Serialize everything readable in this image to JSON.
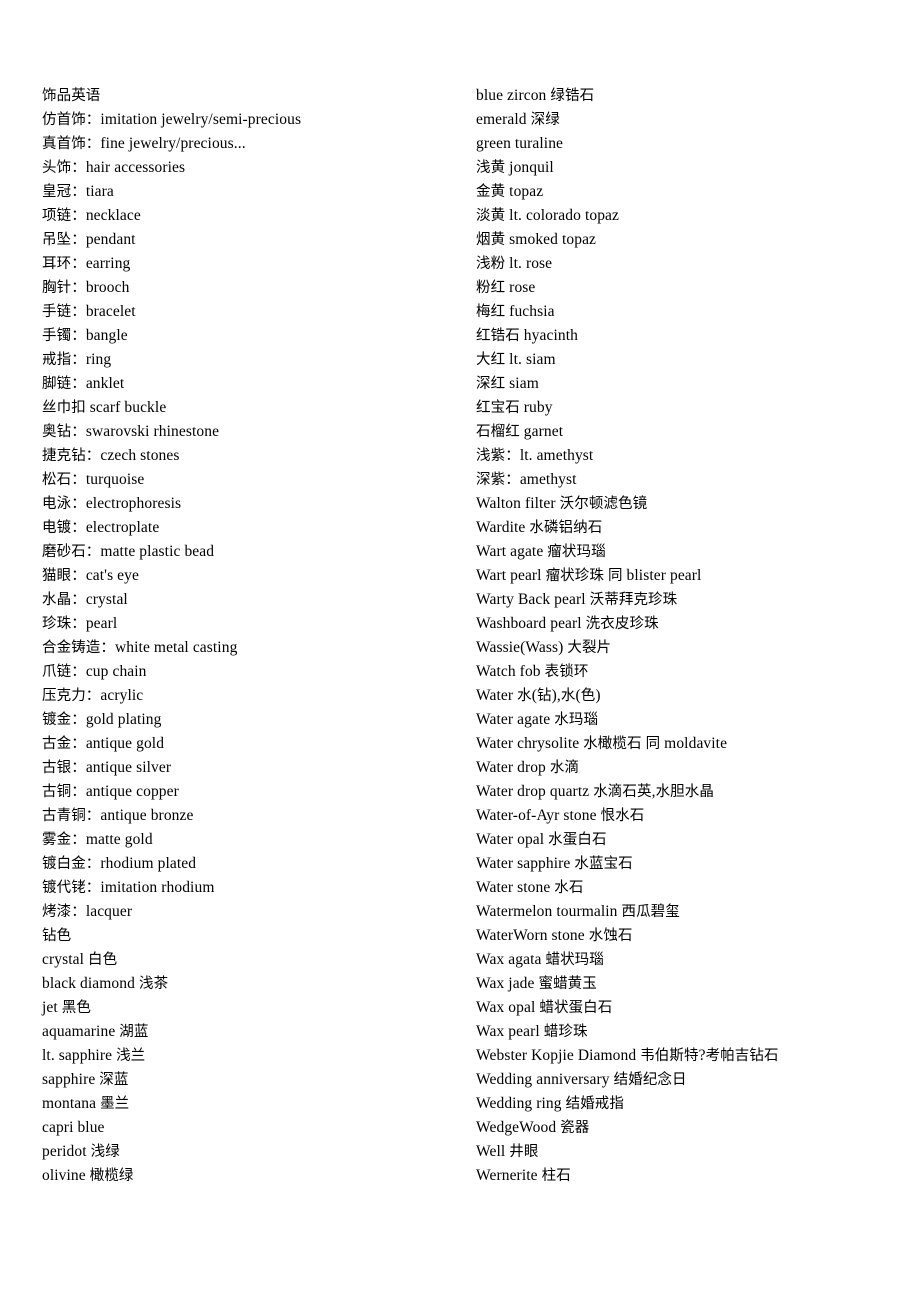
{
  "document": {
    "title": "饰品英语",
    "background_color": "#ffffff",
    "text_color": "#000000",
    "columns": [
      {
        "name": "left-column",
        "lines": [
          "饰品英语",
          "仿首饰：imitation jewelry/semi-precious",
          "真首饰：fine jewelry/precious...",
          "头饰：hair accessories",
          "皇冠：tiara",
          "项链：necklace",
          "吊坠：pendant",
          "耳环：earring",
          "胸针：brooch",
          "手链：bracelet",
          "手镯：bangle",
          "戒指：ring",
          "脚链：anklet",
          "丝巾扣 scarf buckle",
          "奥钻：swarovski rhinestone",
          "捷克钻：czech stones",
          "松石：turquoise",
          "电泳：electrophoresis",
          "电镀：electroplate",
          "磨砂石：matte plastic bead",
          "猫眼：cat's eye",
          "水晶：crystal",
          "珍珠：pearl",
          "合金铸造：white metal casting",
          "爪链：cup chain",
          "压克力：acrylic",
          "镀金：gold plating",
          "古金：antique gold",
          "古银：antique silver",
          "古铜：antique copper",
          "古青铜：antique bronze",
          "雾金：matte gold",
          "镀白金：rhodium plated",
          "镀代铑：imitation rhodium",
          "烤漆：lacquer",
          "钻色",
          "crystal 白色",
          "black diamond 浅茶",
          "jet 黑色",
          "aquamarine 湖蓝",
          "lt. sapphire 浅兰",
          "sapphire 深蓝",
          "montana 墨兰",
          "capri blue",
          "peridot 浅绿",
          "olivine 橄榄绿"
        ]
      },
      {
        "name": "right-column",
        "lines": [
          "blue zircon 绿锆石",
          "emerald 深绿",
          "green turaline",
          "浅黄 jonquil",
          "金黄 topaz",
          "淡黄 lt. colorado topaz",
          "烟黄 smoked topaz",
          "浅粉 lt. rose",
          "粉红 rose",
          "梅红 fuchsia",
          "红锆石 hyacinth",
          "大红 lt. siam",
          "深红 siam",
          "红宝石 ruby",
          "石榴红 garnet",
          "浅紫：lt. amethyst",
          "深紫：amethyst",
          "Walton filter 沃尔顿滤色镜",
          "Wardite 水磷铝纳石",
          "Wart agate 瘤状玛瑙",
          "Wart pearl 瘤状珍珠 同 blister pearl",
          "Warty Back pearl 沃蒂拜克珍珠",
          "Washboard pearl 洗衣皮珍珠",
          "Wassie(Wass) 大裂片",
          "Watch fob 表锁环",
          "Water 水(钻),水(色)",
          "Water agate 水玛瑙",
          "Water chrysolite 水橄榄石 同 moldavite",
          "Water drop 水滴",
          "Water drop quartz 水滴石英,水胆水晶",
          "Water-of-Ayr stone 恨水石",
          "Water opal 水蛋白石",
          "Water sapphire 水蓝宝石",
          "Water stone 水石",
          "Watermelon tourmalin 西瓜碧玺",
          "WaterWorn stone 水蚀石",
          "Wax agata 蜡状玛瑙",
          "Wax jade 蜜蜡黄玉",
          "Wax opal 蜡状蛋白石",
          "Wax pearl 蜡珍珠",
          "Webster Kopjie Diamond 韦伯斯特?考帕吉钻石",
          "Wedding anniversary 结婚纪念日",
          "Wedding ring 结婚戒指",
          "WedgeWood 瓷器",
          "Well 井眼",
          "Wernerite 柱石"
        ]
      }
    ]
  }
}
